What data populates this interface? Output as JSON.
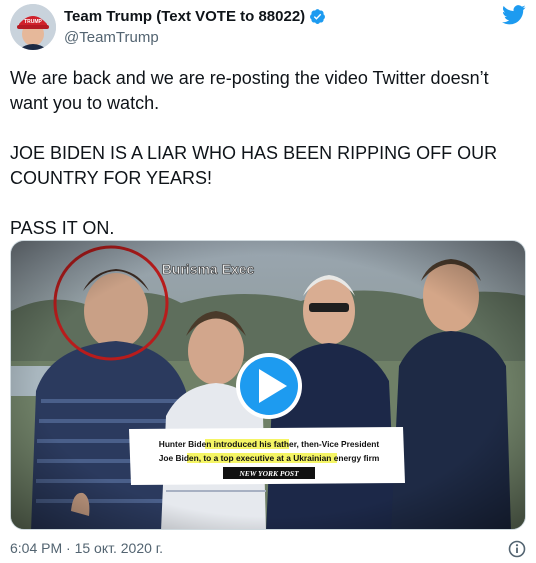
{
  "account": {
    "display_name": "Team Trump (Text VOTE to 88022)",
    "handle": "@TeamTrump",
    "avatar_cap_text": "TRUMP"
  },
  "tweet": {
    "paragraphs": [
      "We are back and we are re-posting the video Twitter doesn’t want you to watch.",
      "JOE BIDEN IS A LIAR WHO HAS BEEN RIPPING OFF OUR COUNTRY FOR YEARS!",
      "PASS IT ON."
    ],
    "timestamp": "6:04 PM · 15 окт. 2020 г."
  },
  "video": {
    "label": "Burisma Exec",
    "caption_line1_plain": "Hunter Biden ",
    "caption_line1_highlight": "introduced his father",
    "caption_line1_rest": ", then-Vice President",
    "caption_line2_plain": "Joe Biden, ",
    "caption_line2_highlight": "to a top executive at a Ukrainian energy firm",
    "source_logo": "NEW YORK POST"
  },
  "icons": {
    "verified": "verified-badge-icon",
    "brand": "twitter-bird-icon",
    "play": "play-icon",
    "info": "info-icon"
  },
  "colors": {
    "brand_blue": "#1d9bf0",
    "text": "#0f1419",
    "secondary_text": "#536471",
    "highlight": "#f3f34a",
    "circle": "#b81c1c"
  }
}
